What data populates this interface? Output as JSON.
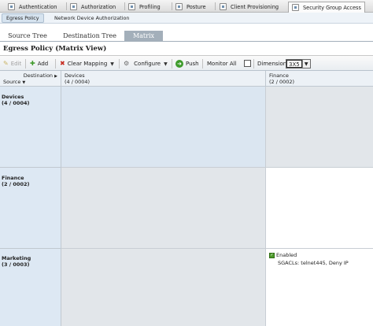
{
  "top_tabs": [
    {
      "label": "Authentication",
      "icon": "authentication-icon"
    },
    {
      "label": "Authorization",
      "icon": "authorization-icon"
    },
    {
      "label": "Profiling",
      "icon": "profiling-icon"
    },
    {
      "label": "Posture",
      "icon": "posture-icon"
    },
    {
      "label": "Client Provisioning",
      "icon": "client-provisioning-icon"
    },
    {
      "label": "Security Group Access",
      "icon": "security-group-access-icon",
      "active": true
    }
  ],
  "sub_tabs": [
    {
      "label": "Egress Policy",
      "active": true
    },
    {
      "label": "Network Device Authorization"
    }
  ],
  "view_tabs": [
    {
      "label": "Source Tree"
    },
    {
      "label": "Destination Tree"
    },
    {
      "label": "Matrix",
      "active": true
    }
  ],
  "page_title": "Egress Policy (Matrix View)",
  "toolbar": {
    "edit": "Edit",
    "add": "Add",
    "clear_mapping": "Clear Mapping",
    "configure": "Configure",
    "push": "Push",
    "monitor_all": "Monitor All",
    "dimension_label": "Dimension",
    "dimension_value": "3X5"
  },
  "matrix": {
    "corner_destination": "Destination",
    "corner_source": "Source",
    "columns": [
      {
        "name": "Devices",
        "code": "(4 / 0004)"
      },
      {
        "name": "Finance",
        "code": "(2 / 0002)"
      }
    ],
    "rows": [
      {
        "name": "Devices",
        "code": "(4 / 0004)"
      },
      {
        "name": "Finance",
        "code": "(2 / 0002)"
      },
      {
        "name": "Marketing",
        "code": "(3 / 0003)"
      }
    ],
    "cell_marketing_finance": {
      "status": "Enabled",
      "sgacls": "SGACLs: telnet445, Deny IP"
    }
  },
  "colors": {
    "active_view_tab": "#a3afba",
    "row_header": "#dde8f3",
    "gray_cell": "#e2e6ea",
    "blue_cell": "#dbe6f1",
    "enabled_green": "#4c9a2a"
  }
}
